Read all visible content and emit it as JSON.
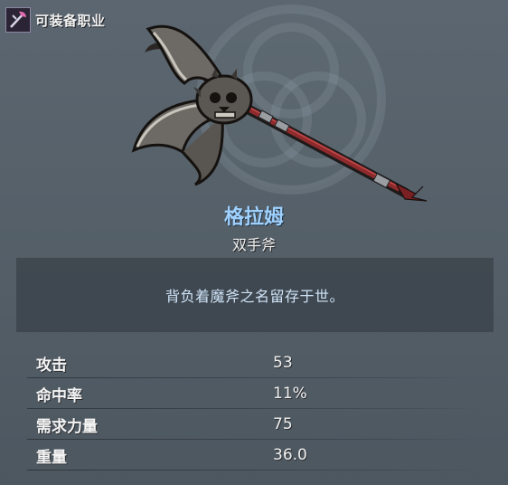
{
  "equip": {
    "label": "可装备职业",
    "icon": "class-axe-icon"
  },
  "item": {
    "name": "格拉姆",
    "type": "双手斧",
    "description": "背负着魔斧之名留存于世。",
    "icon": "skull-battle-axe",
    "name_color": "#9fd1ff"
  },
  "stats": [
    {
      "label": "攻击",
      "value": "53"
    },
    {
      "label": "命中率",
      "value": "11%"
    },
    {
      "label": "需求力量",
      "value": "75"
    },
    {
      "label": "重量",
      "value": "36.0"
    }
  ]
}
